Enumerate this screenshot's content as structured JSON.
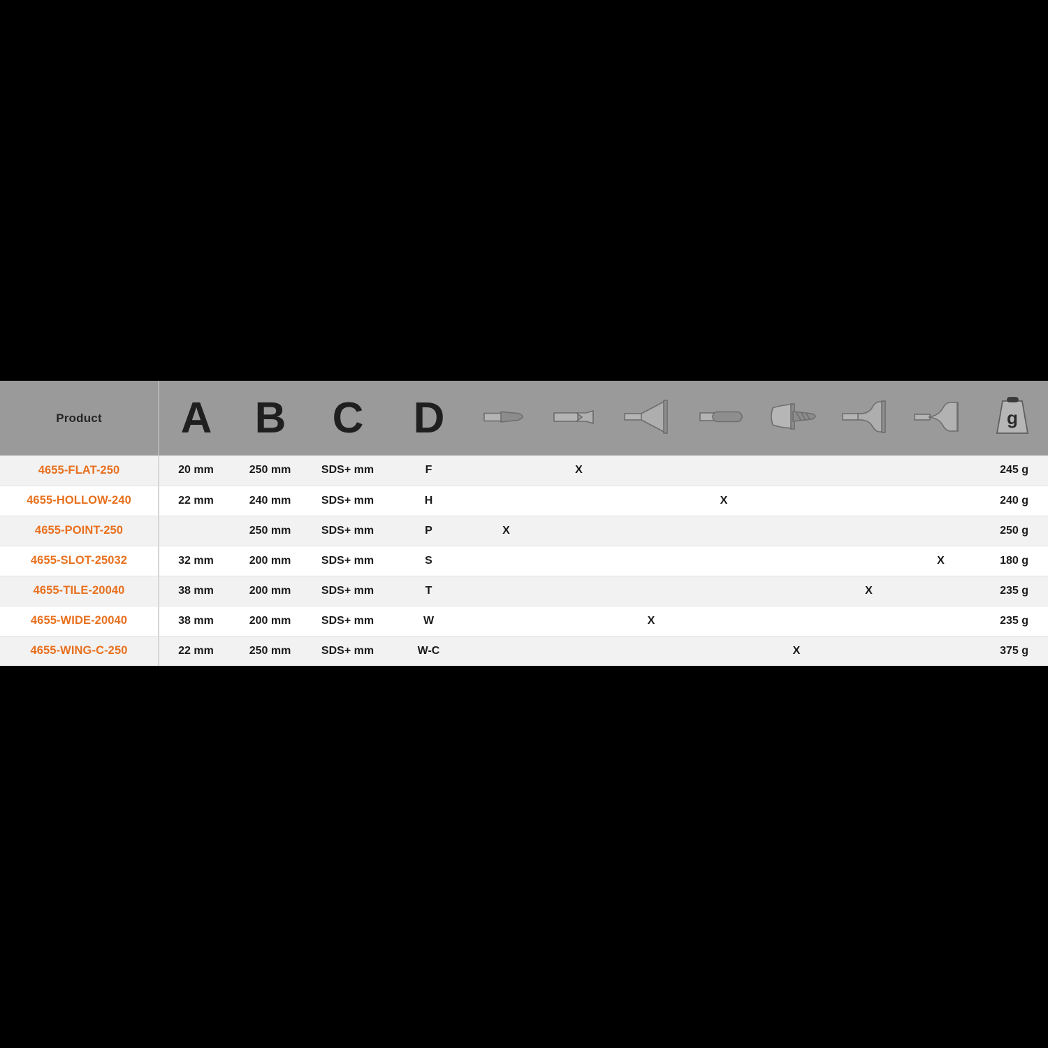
{
  "table": {
    "columns": [
      {
        "key": "product",
        "label": "Product",
        "type": "text-head"
      },
      {
        "key": "a",
        "label": "A",
        "type": "letter"
      },
      {
        "key": "b",
        "label": "B",
        "type": "letter"
      },
      {
        "key": "c",
        "label": "C",
        "type": "letter"
      },
      {
        "key": "d",
        "label": "D",
        "type": "letter"
      },
      {
        "key": "point",
        "label": "point-chisel-icon",
        "type": "icon"
      },
      {
        "key": "flat",
        "label": "flat-chisel-icon",
        "type": "icon"
      },
      {
        "key": "wide",
        "label": "wide-chisel-icon",
        "type": "icon"
      },
      {
        "key": "hollow",
        "label": "hollow-chisel-icon",
        "type": "icon"
      },
      {
        "key": "wing",
        "label": "wing-chisel-icon",
        "type": "icon"
      },
      {
        "key": "tile",
        "label": "tile-chisel-icon",
        "type": "icon"
      },
      {
        "key": "slot",
        "label": "slot-chisel-icon",
        "type": "icon"
      },
      {
        "key": "weight",
        "label": "g",
        "type": "weight-icon"
      }
    ],
    "weight_icon_letter": "g",
    "mark": "X",
    "rows": [
      {
        "product": "4655-FLAT-250",
        "a": "20 mm",
        "b": "250 mm",
        "c": "SDS+ mm",
        "d": "F",
        "point": "",
        "flat": "X",
        "wide": "",
        "hollow": "",
        "wing": "",
        "tile": "",
        "slot": "",
        "weight": "245 g"
      },
      {
        "product": "4655-HOLLOW-240",
        "a": "22 mm",
        "b": "240 mm",
        "c": "SDS+ mm",
        "d": "H",
        "point": "",
        "flat": "",
        "wide": "",
        "hollow": "X",
        "wing": "",
        "tile": "",
        "slot": "",
        "weight": "240 g"
      },
      {
        "product": "4655-POINT-250",
        "a": "",
        "b": "250 mm",
        "c": "SDS+ mm",
        "d": "P",
        "point": "X",
        "flat": "",
        "wide": "",
        "hollow": "",
        "wing": "",
        "tile": "",
        "slot": "",
        "weight": "250 g"
      },
      {
        "product": "4655-SLOT-25032",
        "a": "32 mm",
        "b": "200 mm",
        "c": "SDS+ mm",
        "d": "S",
        "point": "",
        "flat": "",
        "wide": "",
        "hollow": "",
        "wing": "",
        "tile": "",
        "slot": "X",
        "weight": "180 g"
      },
      {
        "product": "4655-TILE-20040",
        "a": "38 mm",
        "b": "200 mm",
        "c": "SDS+ mm",
        "d": "T",
        "point": "",
        "flat": "",
        "wide": "",
        "hollow": "",
        "wing": "",
        "tile": "X",
        "slot": "",
        "weight": "235 g"
      },
      {
        "product": "4655-WIDE-20040",
        "a": "38 mm",
        "b": "200 mm",
        "c": "SDS+ mm",
        "d": "W",
        "point": "",
        "flat": "",
        "wide": "X",
        "hollow": "",
        "wing": "",
        "tile": "",
        "slot": "",
        "weight": "235 g"
      },
      {
        "product": "4655-WING-C-250",
        "a": "22 mm",
        "b": "250 mm",
        "c": "SDS+ mm",
        "d": "W-C",
        "point": "",
        "flat": "",
        "wide": "",
        "hollow": "",
        "wing": "X",
        "tile": "",
        "slot": "",
        "weight": "375 g"
      }
    ]
  },
  "colors": {
    "accent": "#e8701e",
    "header_bg": "#9a9a9a",
    "row_odd": "#f2f2f2",
    "row_even": "#ffffff",
    "page_bg": "#000000",
    "text": "#1a1a1a"
  }
}
